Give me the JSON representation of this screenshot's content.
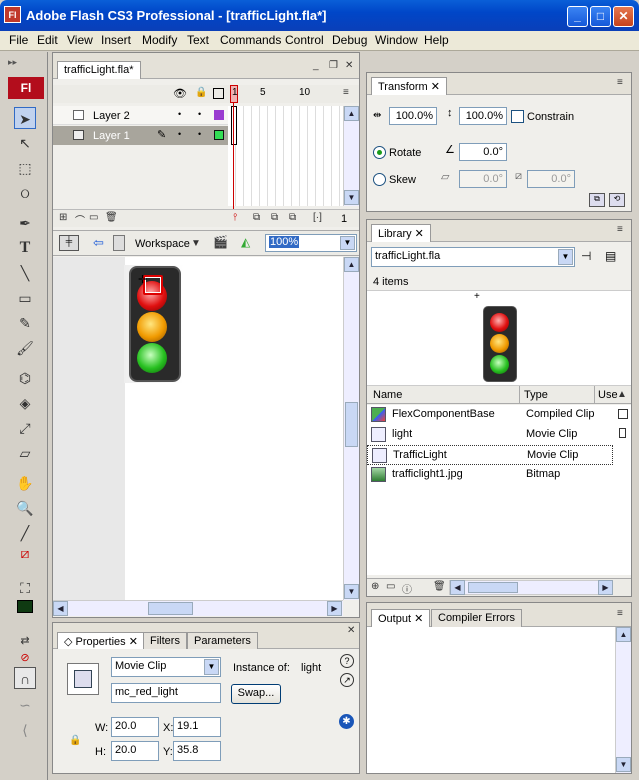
{
  "window": {
    "title": "Adobe Flash CS3 Professional - [trafficLight.fla*]",
    "app_icon": "Fl",
    "min": "_",
    "max": "□",
    "close": "✕"
  },
  "menu": [
    "File",
    "Edit",
    "View",
    "Insert",
    "Modify",
    "Text",
    "Commands",
    "Control",
    "Debug",
    "Window",
    "Help"
  ],
  "tools": {
    "logo": "Fl"
  },
  "timeline": {
    "doc_tab": "trafficLight.fla*",
    "frame_numbers": [
      "1",
      "5",
      "10"
    ],
    "layers": [
      {
        "name": "Layer 2"
      },
      {
        "name": "Layer 1"
      }
    ],
    "footer_frame": "1"
  },
  "stage_toolbar": {
    "workspace": "Workspace",
    "zoom": "100%"
  },
  "properties": {
    "tabs": [
      "Properties",
      "Filters",
      "Parameters"
    ],
    "type": "Movie Clip",
    "instance_of_label": "Instance of:",
    "instance_of": "light",
    "instance_name": "mc_red_light",
    "swap": "Swap...",
    "w_label": "W:",
    "w": "20.0",
    "h_label": "H:",
    "h": "20.0",
    "x_label": "X:",
    "x": "19.1",
    "y_label": "Y:",
    "y": "35.8"
  },
  "transform": {
    "tab": "Transform",
    "width": "100.0%",
    "height": "100.0%",
    "constrain": "Constrain",
    "rotate": "Rotate",
    "rotate_value": "0.0°",
    "skew": "Skew",
    "skew_h": "0.0°",
    "skew_v": "0.0°"
  },
  "library": {
    "tab": "Library",
    "document": "trafficLight.fla",
    "count": "4 items",
    "columns": [
      "Name",
      "Type",
      "Use"
    ],
    "items": [
      {
        "name": "FlexComponentBase",
        "type": "Compiled Clip"
      },
      {
        "name": "light",
        "type": "Movie Clip"
      },
      {
        "name": "TrafficLight",
        "type": "Movie Clip"
      },
      {
        "name": "trafficlight1.jpg",
        "type": "Bitmap"
      }
    ]
  },
  "output": {
    "tabs": [
      "Output",
      "Compiler Errors"
    ]
  },
  "colors": {
    "titlebar": "#0a5fd8",
    "accent": "#316ac5",
    "flash_red": "#b30d1c"
  }
}
